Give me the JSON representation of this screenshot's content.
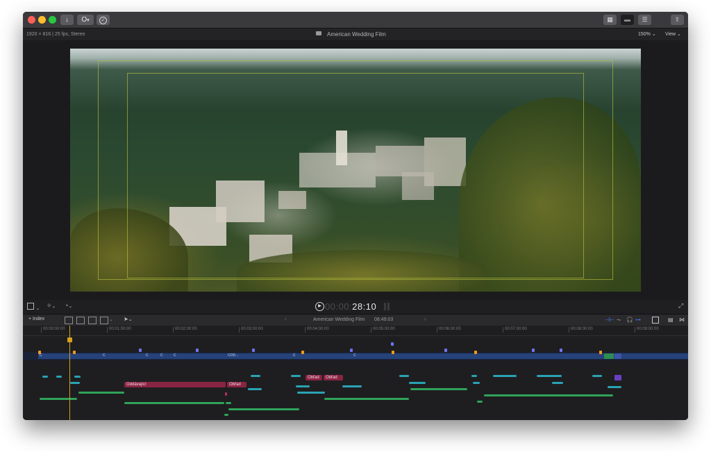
{
  "toolbar": {
    "import_icon": "download-icon",
    "keyword_label": "O",
    "keyword_icon": "key-icon",
    "check_icon": "checkmark-icon",
    "share_icon": "share-icon"
  },
  "viewer": {
    "format_info": "1920 × 816 | 25 fps, Stereo",
    "project_title": "American Wedding Film",
    "zoom": "150%",
    "view_menu": "View"
  },
  "playback": {
    "timecode_dim": "00:00:",
    "timecode": "28:10"
  },
  "timeline_bar": {
    "index_label": "Index",
    "project_name": "American Wedding Film",
    "duration": "08:49:03"
  },
  "ruler": {
    "ticks": [
      "00:00:00:00",
      "00:01:00:00",
      "00:02:00:00",
      "00:03:00:00",
      "00:04:00:00",
      "00:05:00:00",
      "00:06:00:00",
      "00:07:00:00",
      "00:08:00:00",
      "00:09:00:00"
    ]
  },
  "clips": {
    "connected_1": "Oddávající",
    "connected_2": "Obřad",
    "connected_3": "Obřad",
    "connected_4": "Obřad",
    "primary_1": "C",
    "primary_2": "COD..."
  },
  "colors": {
    "accent_blue": "#2f7bf6",
    "playhead": "#d8a01c",
    "audio_green": "#2fa35a",
    "title_magenta": "#8a2443",
    "title_teal": "#2aa3b4"
  }
}
